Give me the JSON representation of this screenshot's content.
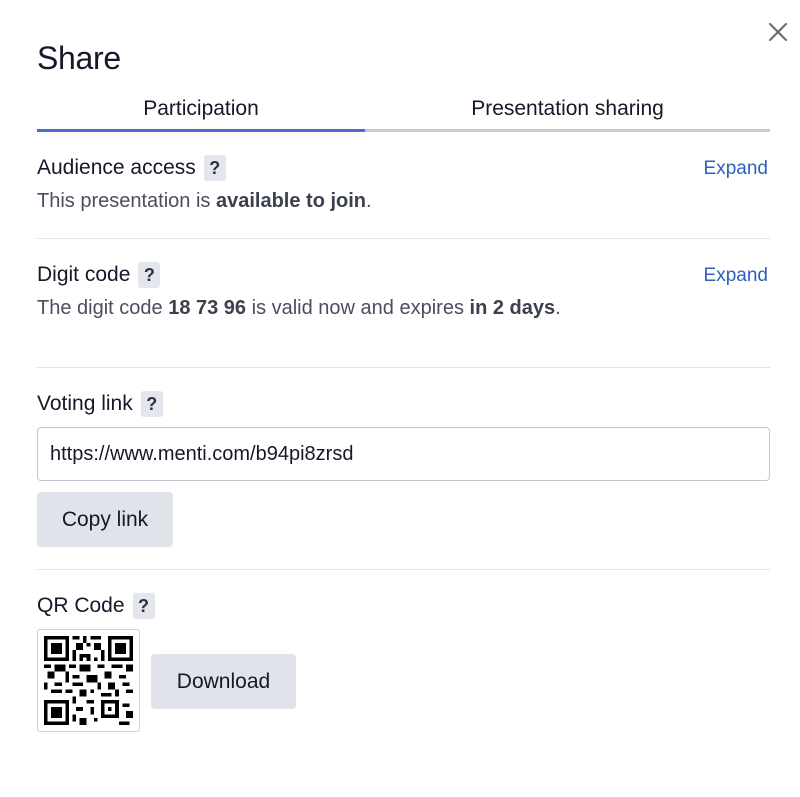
{
  "dialog": {
    "title": "Share",
    "close_icon": "close-icon"
  },
  "tabs": [
    {
      "label": "Participation",
      "active": true
    },
    {
      "label": "Presentation sharing",
      "active": false
    }
  ],
  "colors": {
    "accent": "#4a6bd1",
    "link": "#2f5fbf",
    "button_bg": "#e1e3ea"
  },
  "audience_access": {
    "heading": "Audience access",
    "help": "?",
    "expand": "Expand",
    "text_prefix": "This presentation is ",
    "text_bold": "available to join",
    "text_suffix": "."
  },
  "digit_code": {
    "heading": "Digit code",
    "help": "?",
    "expand": "Expand",
    "text_prefix": "The digit code ",
    "code": "18 73 96",
    "text_middle": " is valid now and expires ",
    "expires": "in 2 days",
    "text_suffix": "."
  },
  "voting_link": {
    "heading": "Voting link",
    "help": "?",
    "url": "https://www.menti.com/b94pi8zrsd",
    "copy_label": "Copy link"
  },
  "qr_code": {
    "heading": "QR Code",
    "help": "?",
    "download_label": "Download"
  }
}
